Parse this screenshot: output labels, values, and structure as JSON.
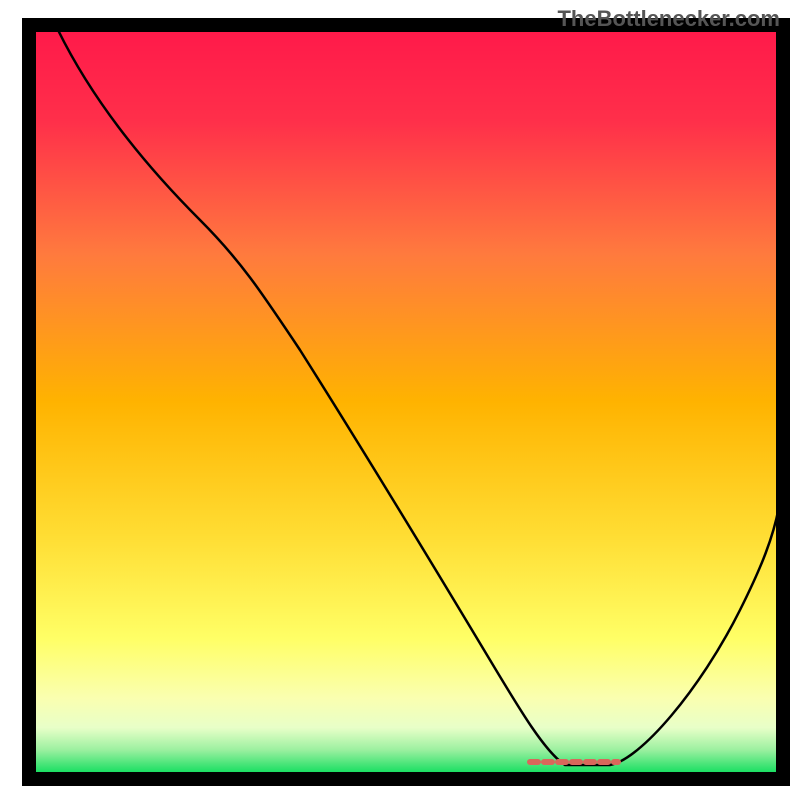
{
  "watermark": "TheBottlenecker.com",
  "chart_data": {
    "type": "line",
    "title": "",
    "xlabel": "",
    "ylabel": "",
    "xlim": [
      0,
      100
    ],
    "ylim": [
      0,
      100
    ],
    "background": {
      "type": "vertical-gradient",
      "stops": [
        {
          "pos": 0,
          "color": "#ff1a4a"
        },
        {
          "pos": 50,
          "color": "#ffb300"
        },
        {
          "pos": 80,
          "color": "#ffff66"
        },
        {
          "pos": 94,
          "color": "#f8ffc0"
        },
        {
          "pos": 100,
          "color": "#1bdf63"
        }
      ]
    },
    "series": [
      {
        "name": "bottleneck-curve",
        "color": "#000000",
        "width": 2,
        "points": [
          {
            "x": 3,
            "y": 100
          },
          {
            "x": 10,
            "y": 90
          },
          {
            "x": 20,
            "y": 78
          },
          {
            "x": 27,
            "y": 70
          },
          {
            "x": 35,
            "y": 58
          },
          {
            "x": 45,
            "y": 40
          },
          {
            "x": 55,
            "y": 22
          },
          {
            "x": 62,
            "y": 9
          },
          {
            "x": 68,
            "y": 0.8
          },
          {
            "x": 78,
            "y": 0.8
          },
          {
            "x": 85,
            "y": 9
          },
          {
            "x": 92,
            "y": 23
          },
          {
            "x": 100,
            "y": 40
          }
        ]
      },
      {
        "name": "optimum-marker",
        "color": "#d9675b",
        "width": 5,
        "points": [
          {
            "x": 67,
            "y": 1.3
          },
          {
            "x": 78,
            "y": 1.3
          }
        ]
      }
    ],
    "frame": {
      "color": "#000000",
      "width": 14
    }
  }
}
